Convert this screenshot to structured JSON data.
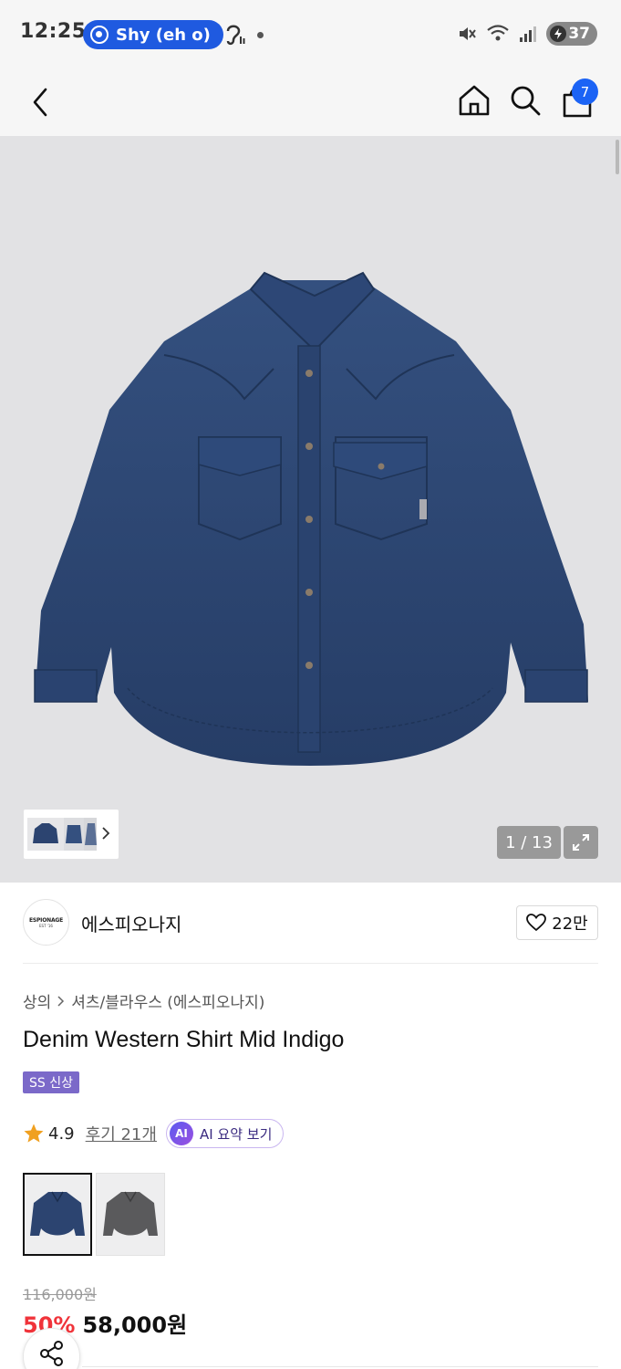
{
  "status_bar": {
    "time": "12:25",
    "media_pill": "Shy (eh o)",
    "battery": "37"
  },
  "header": {
    "cart_count": "7"
  },
  "gallery": {
    "counter": "1 / 13"
  },
  "brand": {
    "logo_line1": "ESPIONAGE",
    "logo_line2": "EST '16",
    "name": "에스피오나지",
    "likes": "22만"
  },
  "product": {
    "breadcrumb": [
      "상의",
      "셔츠/블라우스 (에스피오나지)"
    ],
    "title": "Denim Western Shirt Mid Indigo",
    "tag": "SS 신상",
    "rating": "4.9",
    "reviews": "후기 21개",
    "ai_badge": "AI",
    "ai_summary": "AI 요약 보기",
    "original_price": "116,000원",
    "discount": "50%",
    "price": "58,000원"
  },
  "colors": {
    "star": "#f0a020",
    "accent_blue": "#1b63f5",
    "discount_red": "#f0333a",
    "tag_purple": "#7b69c9",
    "denim": "#2c4470"
  }
}
